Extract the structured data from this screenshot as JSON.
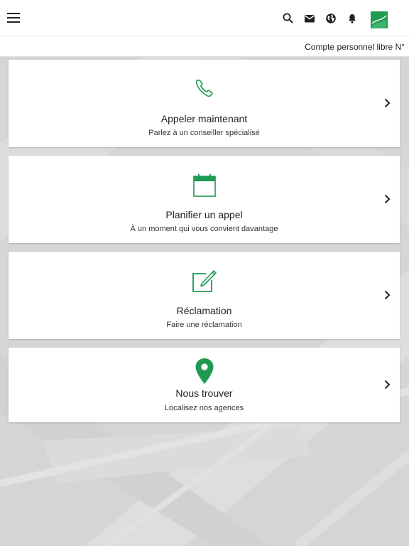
{
  "topbar": {
    "menu_icon": "hamburger-menu-icon",
    "icons": [
      "search-icon",
      "mail-icon",
      "globe-icon",
      "bell-icon"
    ],
    "logo_icon": "bank-logo-icon",
    "brand_color": "#1e9a52"
  },
  "account": {
    "label": "Compte personnel libre N°"
  },
  "cards": [
    {
      "icon": "phone-icon",
      "title": "Appeler maintenant",
      "subtitle": "Parlez à un conseiller spécialisé"
    },
    {
      "icon": "calendar-icon",
      "title": "Planifier un appel",
      "subtitle": "À un moment qui vous convient davantage"
    },
    {
      "icon": "edit-icon",
      "title": "Réclamation",
      "subtitle": "Faire une réclamation"
    },
    {
      "icon": "map-pin-icon",
      "title": "Nous trouver",
      "subtitle": "Localisez nos agences"
    }
  ],
  "colors": {
    "accent": "#1e9a52",
    "background": "#d2d5d4"
  }
}
